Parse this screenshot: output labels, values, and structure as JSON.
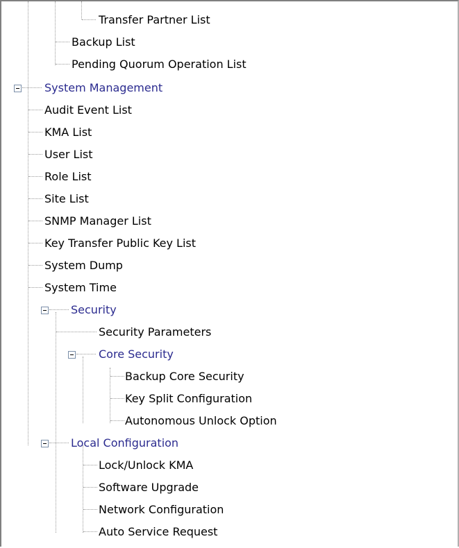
{
  "tree": {
    "items": [
      {
        "label": "Transfer Partner List"
      },
      {
        "label": "Backup List"
      },
      {
        "label": "Pending Quorum Operation List"
      },
      {
        "label": "System Management"
      },
      {
        "label": "Audit Event List"
      },
      {
        "label": "KMA List"
      },
      {
        "label": "User List"
      },
      {
        "label": "Role List"
      },
      {
        "label": "Site List"
      },
      {
        "label": "SNMP Manager List"
      },
      {
        "label": "Key Transfer Public Key List"
      },
      {
        "label": "System Dump"
      },
      {
        "label": "System Time"
      },
      {
        "label": "Security"
      },
      {
        "label": "Security Parameters"
      },
      {
        "label": "Core Security"
      },
      {
        "label": "Backup Core Security"
      },
      {
        "label": "Key Split Configuration"
      },
      {
        "label": "Autonomous Unlock Option"
      },
      {
        "label": "Local Configuration"
      },
      {
        "label": "Lock/Unlock KMA"
      },
      {
        "label": "Software Upgrade"
      },
      {
        "label": "Network Configuration"
      },
      {
        "label": "Auto Service Request"
      }
    ]
  },
  "colors": {
    "folder_text": "#2b2b8f",
    "connector": "#9a9a9a",
    "border": "#808080"
  },
  "icons": {
    "expanded_toggle": "minus-box-icon"
  }
}
